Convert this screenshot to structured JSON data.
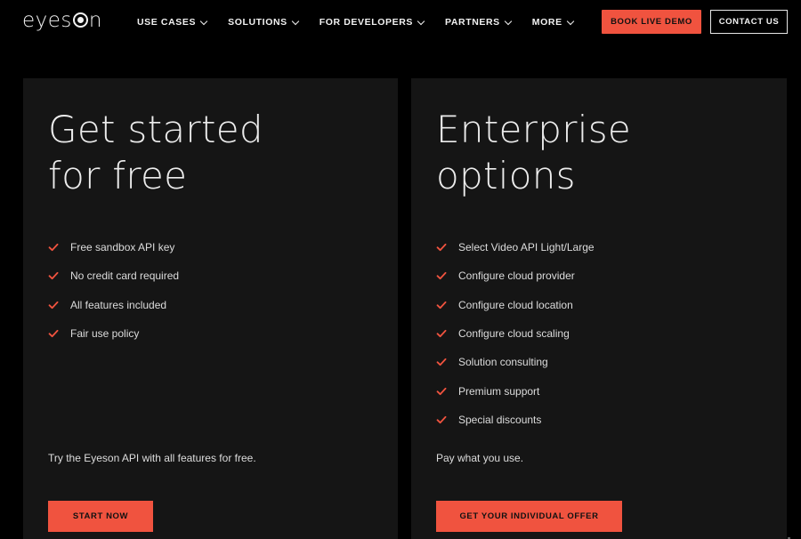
{
  "nav": {
    "logo": {
      "pre": "eyes",
      "post": "n"
    },
    "menu": [
      "USE CASES",
      "SOLUTIONS",
      "FOR DEVELOPERS",
      "PARTNERS",
      "MORE"
    ],
    "book_demo": "BOOK LIVE DEMO",
    "contact": "CONTACT US"
  },
  "cards": {
    "free": {
      "title_line1": "Get started",
      "title_line2": "for free",
      "features": [
        "Free sandbox API key",
        "No credit card required",
        "All features included",
        "Fair use policy"
      ],
      "description": "Try the Eyeson API with all features for free.",
      "cta": "START NOW"
    },
    "enterprise": {
      "title_line1": "Enterprise",
      "title_line2": "options",
      "features": [
        "Select Video API Light/Large",
        "Configure cloud provider",
        "Configure cloud location",
        "Configure cloud scaling",
        "Solution consulting",
        "Premium support",
        "Special discounts"
      ],
      "description": "Pay what you use.",
      "cta": "GET YOUR INDIVIDUAL OFFER"
    }
  },
  "colors": {
    "accent": "#f0533f",
    "background": "#000000",
    "card": "#151515",
    "text": "#dcdcdc"
  },
  "icons": {
    "feature_bullet": "check-icon",
    "menu_dropdown": "chevron-down-icon"
  }
}
